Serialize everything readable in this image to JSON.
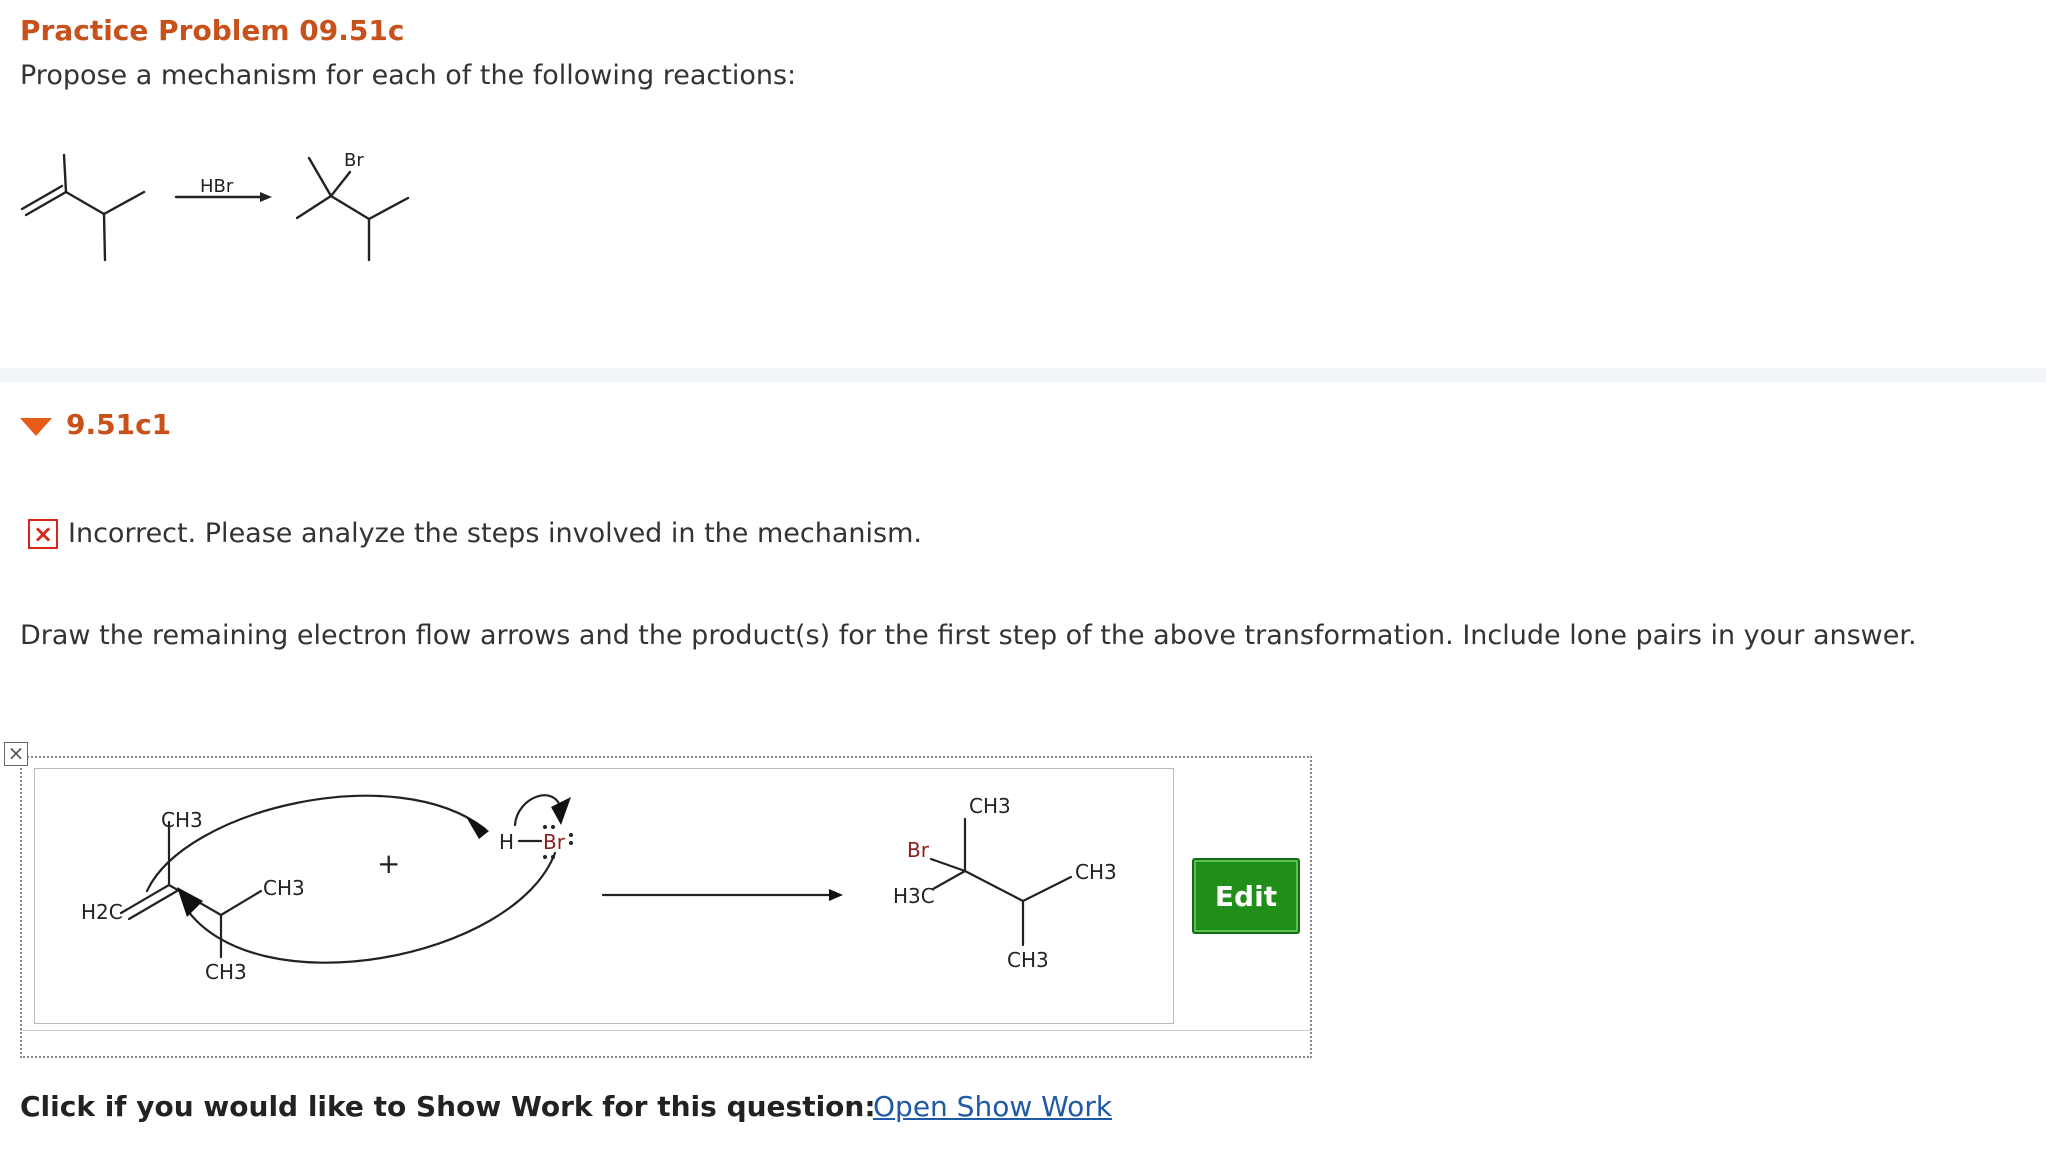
{
  "problem": {
    "title": "Practice Problem 09.51c",
    "prompt": "Propose a mechanism for each of the following reactions:",
    "reagent": "HBr",
    "product_substituent": "Br"
  },
  "part": {
    "label": "9.51c1"
  },
  "feedback": {
    "status": "incorrect",
    "text": "Incorrect. Please analyze the steps involved in the mechanism."
  },
  "instructions": "Draw the remaining electron flow arrows and the product(s) for the first step of the above transformation. Include lone pairs in your answer.",
  "drawing": {
    "reactant_labels": [
      "CH3",
      "H2C",
      "CH3",
      "CH3"
    ],
    "plus_sign": "+",
    "hbr_labels": [
      "H",
      "Br"
    ],
    "product_labels": [
      "Br",
      "CH3",
      "H3C",
      "CH3",
      "CH3"
    ]
  },
  "controls": {
    "edit_label": "Edit",
    "show_work_prompt": "Click if you would like to Show Work for this question:",
    "show_work_link": "Open Show Work"
  },
  "colors": {
    "title": "#c8501a",
    "accent_arrow": "#e85c1a",
    "error": "#d9261c",
    "edit_button": "#1f8f19",
    "link": "#1f5aa8",
    "bromine": "#8b1e1e"
  }
}
